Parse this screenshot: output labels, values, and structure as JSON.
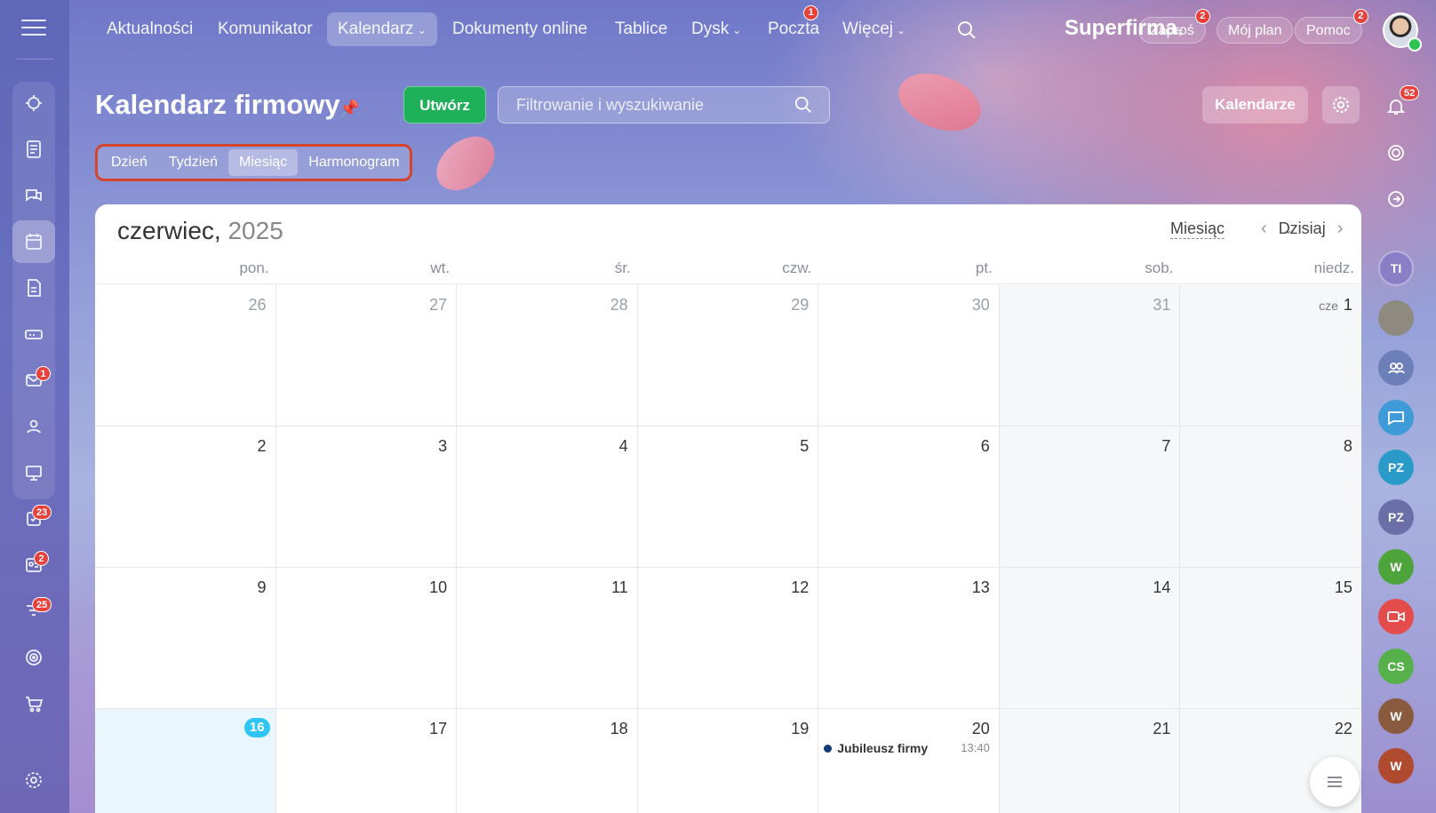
{
  "nav": {
    "items": [
      {
        "label": "Aktualności"
      },
      {
        "label": "Komunikator"
      },
      {
        "label": "Kalendarz",
        "chevron": "⌄"
      },
      {
        "label": "Dokumenty online"
      },
      {
        "label": "Tablice"
      },
      {
        "label": "Dysk",
        "chevron": "⌄"
      },
      {
        "label": "Poczta",
        "badge": "1"
      },
      {
        "label": "Więcej",
        "chevron": "⌄"
      }
    ],
    "brand": "Superfirma",
    "invite": {
      "label": "Zaproś",
      "badge": "2"
    },
    "plan": "Mój plan",
    "help": {
      "label": "Pomoc",
      "badge": "2"
    }
  },
  "rail": {
    "badges": {
      "mail": "1",
      "tasks": "23",
      "crm": "2",
      "filters": "25"
    }
  },
  "header": {
    "title": "Kalendarz firmowy",
    "create_label": "Utwórz",
    "search_placeholder": "Filtrowanie i wyszukiwanie",
    "calendars_label": "Kalendarze"
  },
  "views": [
    {
      "label": "Dzień"
    },
    {
      "label": "Tydzień"
    },
    {
      "label": "Miesiąc",
      "active": true
    },
    {
      "label": "Harmonogram"
    }
  ],
  "calendar": {
    "month": "czerwiec,",
    "year": "2025",
    "view_select": "Miesiąc",
    "today_label": "Dzisiaj",
    "weekdays": [
      "pon.",
      "wt.",
      "śr.",
      "czw.",
      "pt.",
      "sob.",
      "niedz."
    ],
    "weeks": [
      [
        "26",
        "27",
        "28",
        "29",
        "30",
        "31",
        "1"
      ],
      [
        "2",
        "3",
        "4",
        "5",
        "6",
        "7",
        "8"
      ],
      [
        "9",
        "10",
        "11",
        "12",
        "13",
        "14",
        "15"
      ],
      [
        "16",
        "17",
        "18",
        "19",
        "20",
        "21",
        "22"
      ]
    ],
    "first_month_label": "cze",
    "today": "16",
    "event": {
      "name": "Jubileusz firmy",
      "time": "13:40",
      "day": "20"
    }
  },
  "right_rail": {
    "notifications_badge": "52",
    "avatars": [
      "TI",
      "PZ",
      "PZ",
      "W",
      "CS",
      "W",
      "W"
    ]
  },
  "colors": {
    "accent_green": "#1fb05a",
    "today_blue": "#2fc6f6",
    "highlight_red": "#d6442c",
    "badge_red": "#e8413b"
  }
}
